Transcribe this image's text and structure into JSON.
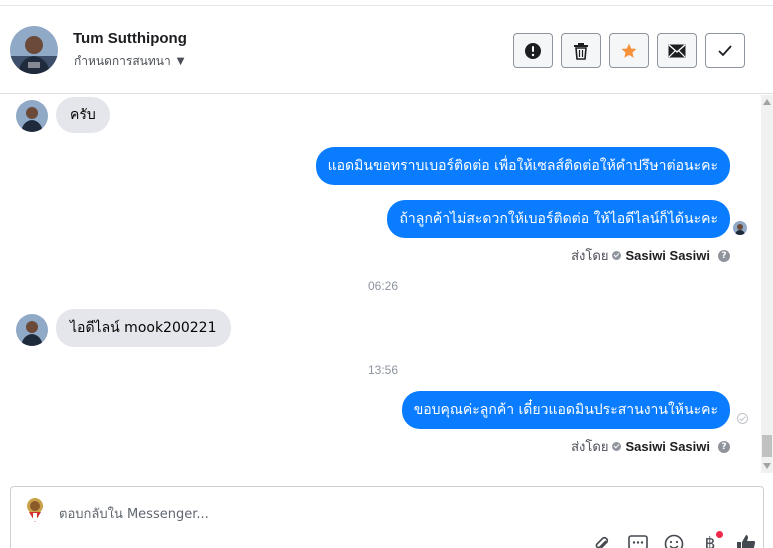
{
  "header": {
    "contact_name": "Tum Sutthipong",
    "conversation_setting": "กำหนดการสนทนา",
    "actions": [
      {
        "name": "mark-spam",
        "icon": "exclamation-circle-icon"
      },
      {
        "name": "delete",
        "icon": "trash-icon"
      },
      {
        "name": "star",
        "icon": "star-icon",
        "color": "#f7923b"
      },
      {
        "name": "mark-unread",
        "icon": "envelope-icon"
      },
      {
        "name": "mark-done",
        "icon": "checkmark-icon"
      }
    ]
  },
  "thread": {
    "msg1_text": "ครับ",
    "msg2_text": "แอดมินขอทราบเบอร์ติดต่อ เพื่อให้เซลส์ติดต่อให้คำปรึษาต่อนะคะ",
    "msg3_text": "ถ้าลูกค้าไม่สะดวกให้เบอร์ติดต่อ ให้ไอดีไลน์ก็ได้นะคะ",
    "sent_by_label": "ส่งโดย",
    "agent_name": "Sasiwi Sasiwi",
    "time1": "06:26",
    "msg4_text": "ไอดีไลน์ mook200221",
    "time2": "13:56",
    "msg5_text": "ขอบคุณค่ะลูกค้า เดี๋ยวแอดมินประสานงานให้นะคะ"
  },
  "composer": {
    "placeholder": "ตอบกลับใน Messenger..."
  },
  "colors": {
    "outgoing_bubble": "#0a7cff",
    "incoming_bubble": "#e4e6eb",
    "star": "#f7923b",
    "notification_dot": "#f02849"
  }
}
